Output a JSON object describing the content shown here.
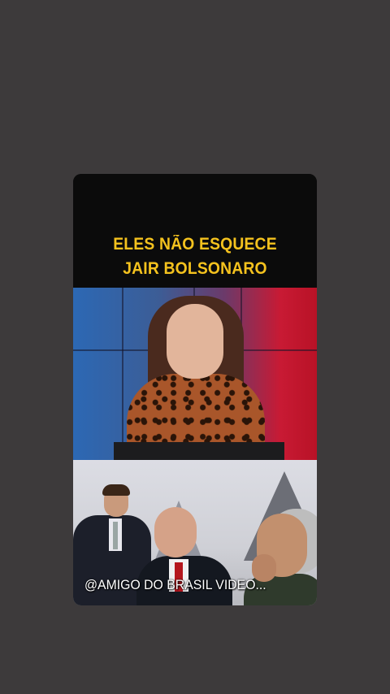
{
  "post": {
    "headline_line1": "ELES NÃO ESQUECE",
    "headline_line2": "JAIR BOLSONARO",
    "watermark": "@AMIGO DO BRASIL VIDEO..."
  },
  "colors": {
    "background": "#3d3a3b",
    "headline": "#f4c21e",
    "headline_band": "#0b0b0b",
    "studio_left": "#2c68b4",
    "studio_right": "#c81a34"
  }
}
